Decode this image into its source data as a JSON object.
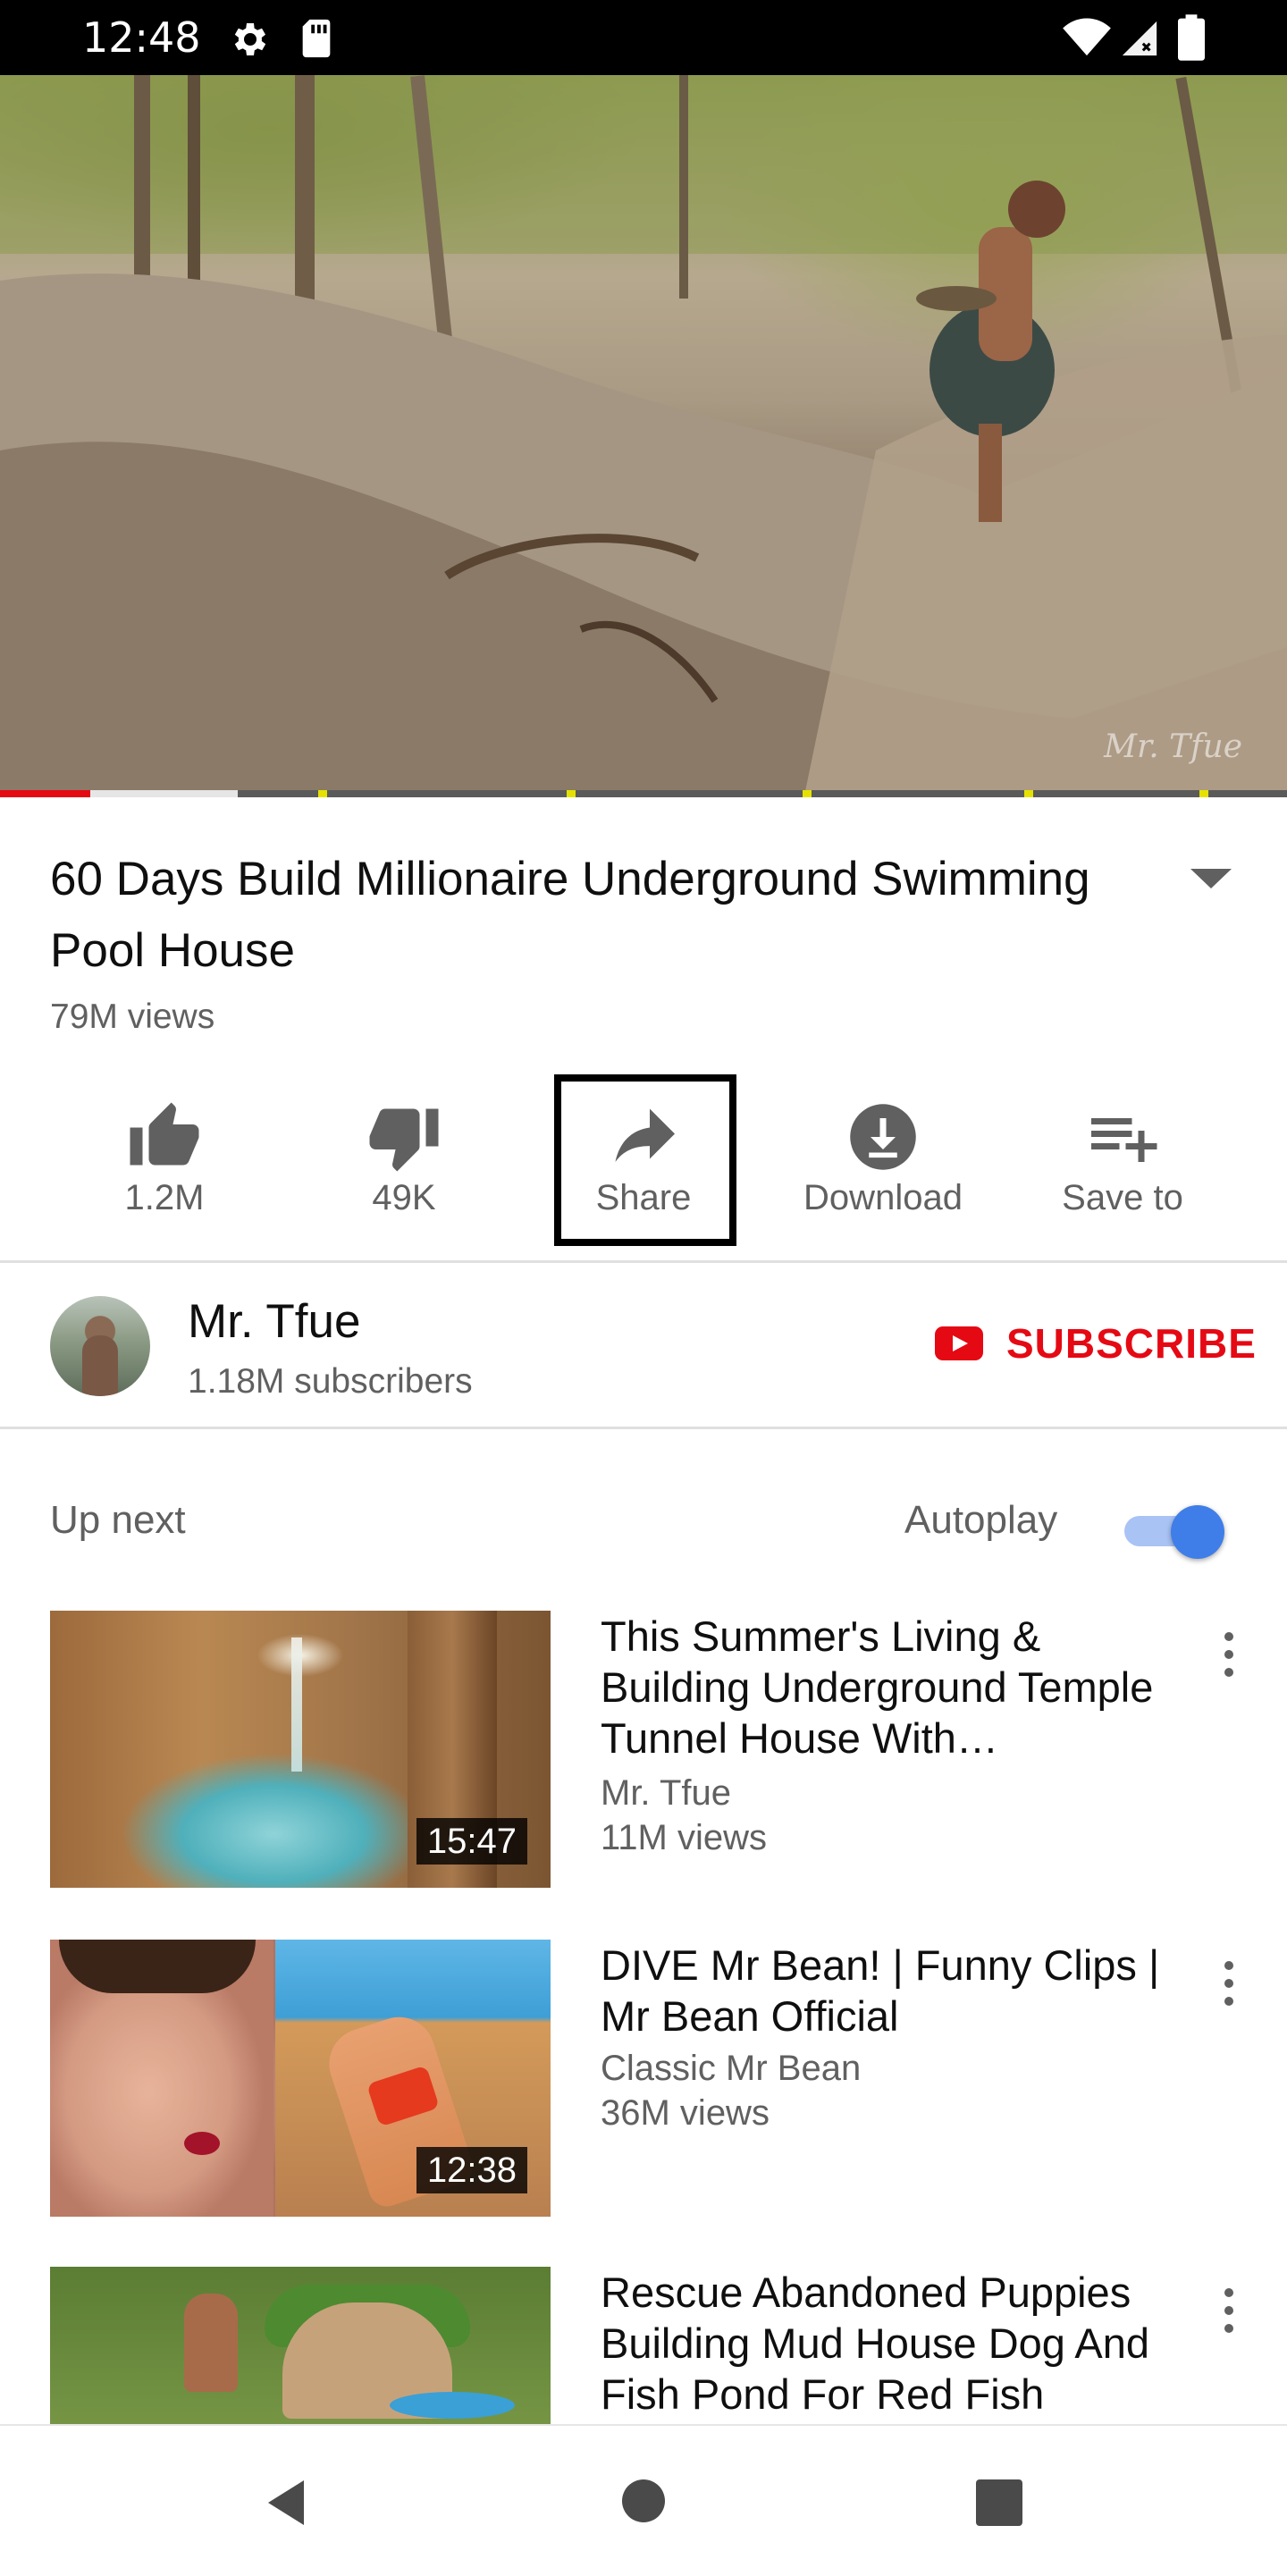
{
  "status_bar": {
    "time": "12:48"
  },
  "video": {
    "title": "60 Days Build Millionaire Underground Swimming Pool House",
    "views": "79M views",
    "watermark": "Mr. Tfue",
    "played_fraction": 0.07,
    "buffered_fraction": 0.185
  },
  "actions": {
    "like": "1.2M",
    "dislike": "49K",
    "share": "Share",
    "download": "Download",
    "save": "Save to"
  },
  "channel": {
    "name": "Mr. Tfue",
    "subscribers": "1.18M subscribers",
    "subscribe_label": "SUBSCRIBE"
  },
  "up_next": {
    "label": "Up next",
    "autoplay_label": "Autoplay",
    "autoplay_on": true
  },
  "videos": [
    {
      "title": "This Summer's Living & Building Underground Temple Tunnel House With…",
      "channel": "Mr. Tfue",
      "views": "11M views",
      "duration": "15:47"
    },
    {
      "title": "DIVE Mr Bean! | Funny Clips | Mr Bean Official",
      "channel": "Classic Mr Bean",
      "views": "36M views",
      "duration": "12:38"
    },
    {
      "title": "Rescue Abandoned Puppies Building Mud House Dog And Fish Pond For Red Fish",
      "channel": "",
      "views": "",
      "duration": ""
    }
  ],
  "colors": {
    "youtube_red": "#e50914",
    "toggle_blue": "#3f7ee8",
    "secondary_text": "#606060"
  }
}
